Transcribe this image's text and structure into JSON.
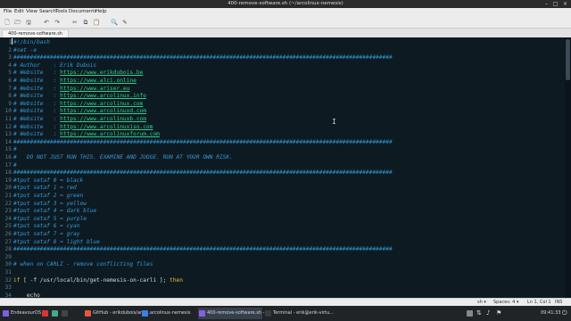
{
  "window": {
    "title": "400-remove-software.sh (~/arcolinux-nemesis)",
    "minimize": "–",
    "maximize": "□",
    "close": "×"
  },
  "menu": [
    "File",
    "Edit",
    "View",
    "Search",
    "Tools",
    "Documents",
    "Help"
  ],
  "toolbar": {
    "new": "🗋",
    "open": "🗁",
    "save": "🖫",
    "undo": "↶",
    "redo": "↷",
    "cut": "✂",
    "copy": "⧉",
    "paste": "📋",
    "find": "🔍",
    "replace": "✎"
  },
  "tab": {
    "label": "400-remove-software.sh"
  },
  "editor": {
    "lines": [
      {
        "n": "1",
        "segs": [
          {
            "c": "cm",
            "t": "#!/bin/bash"
          }
        ]
      },
      {
        "n": "2",
        "segs": [
          {
            "c": "cm",
            "t": "#set -e"
          }
        ]
      },
      {
        "n": "3",
        "segs": [
          {
            "c": "cm",
            "t": "##################################################################################################################"
          }
        ]
      },
      {
        "n": "4",
        "segs": [
          {
            "c": "cm",
            "t": "# Author    : Erik Dubois"
          }
        ]
      },
      {
        "n": "5",
        "segs": [
          {
            "c": "cm",
            "t": "# Website   : "
          },
          {
            "c": "url",
            "t": "https://www.erikdubois.be"
          }
        ]
      },
      {
        "n": "6",
        "segs": [
          {
            "c": "cm",
            "t": "# Website   : "
          },
          {
            "c": "url",
            "t": "https://www.alci.online"
          }
        ]
      },
      {
        "n": "7",
        "segs": [
          {
            "c": "cm",
            "t": "# Website   : "
          },
          {
            "c": "url",
            "t": "https://www.ariser.eu"
          }
        ]
      },
      {
        "n": "8",
        "segs": [
          {
            "c": "cm",
            "t": "# Website   : "
          },
          {
            "c": "url",
            "t": "https://www.arcolinux.info"
          }
        ]
      },
      {
        "n": "9",
        "segs": [
          {
            "c": "cm",
            "t": "# Website   : "
          },
          {
            "c": "url",
            "t": "https://www.arcolinux.com"
          }
        ]
      },
      {
        "n": "10",
        "segs": [
          {
            "c": "cm",
            "t": "# Website   : "
          },
          {
            "c": "url",
            "t": "https://www.arcolinuxd.com"
          }
        ]
      },
      {
        "n": "11",
        "segs": [
          {
            "c": "cm",
            "t": "# Website   : "
          },
          {
            "c": "url",
            "t": "https://www.arcolinuxb.com"
          }
        ]
      },
      {
        "n": "12",
        "segs": [
          {
            "c": "cm",
            "t": "# Website   : "
          },
          {
            "c": "url",
            "t": "https://www.arcolinuxiso.com"
          }
        ]
      },
      {
        "n": "13",
        "segs": [
          {
            "c": "cm",
            "t": "# Website   : "
          },
          {
            "c": "url",
            "t": "https://www.arcolinuxforum.com"
          }
        ]
      },
      {
        "n": "14",
        "segs": [
          {
            "c": "cm",
            "t": "##################################################################################################################"
          }
        ]
      },
      {
        "n": "15",
        "segs": [
          {
            "c": "cm",
            "t": "#"
          }
        ]
      },
      {
        "n": "16",
        "segs": [
          {
            "c": "cm",
            "t": "#   DO NOT JUST RUN THIS. EXAMINE AND JUDGE. RUN AT YOUR OWN RISK."
          }
        ]
      },
      {
        "n": "17",
        "segs": [
          {
            "c": "cm",
            "t": "#"
          }
        ]
      },
      {
        "n": "18",
        "segs": [
          {
            "c": "cm",
            "t": "##################################################################################################################"
          }
        ]
      },
      {
        "n": "19",
        "segs": [
          {
            "c": "cm",
            "t": "#tput setaf 0 = black"
          }
        ]
      },
      {
        "n": "20",
        "segs": [
          {
            "c": "cm",
            "t": "#tput setaf 1 = red"
          }
        ]
      },
      {
        "n": "21",
        "segs": [
          {
            "c": "cm",
            "t": "#tput setaf 2 = green"
          }
        ]
      },
      {
        "n": "22",
        "segs": [
          {
            "c": "cm",
            "t": "#tput setaf 3 = yellow"
          }
        ]
      },
      {
        "n": "23",
        "segs": [
          {
            "c": "cm",
            "t": "#tput setaf 4 = dark blue"
          }
        ]
      },
      {
        "n": "24",
        "segs": [
          {
            "c": "cm",
            "t": "#tput setaf 5 = purple"
          }
        ]
      },
      {
        "n": "25",
        "segs": [
          {
            "c": "cm",
            "t": "#tput setaf 6 = cyan"
          }
        ]
      },
      {
        "n": "26",
        "segs": [
          {
            "c": "cm",
            "t": "#tput setaf 7 = gray"
          }
        ]
      },
      {
        "n": "27",
        "segs": [
          {
            "c": "cm",
            "t": "#tput setaf 8 = light blue"
          }
        ]
      },
      {
        "n": "28",
        "segs": [
          {
            "c": "cm",
            "t": "##################################################################################################################"
          }
        ]
      },
      {
        "n": "29",
        "segs": []
      },
      {
        "n": "30",
        "segs": [
          {
            "c": "cm",
            "t": "# when on CARLI - remove conflicting files"
          }
        ]
      },
      {
        "n": "31",
        "segs": []
      },
      {
        "n": "32",
        "segs": [
          {
            "c": "kw",
            "t": "if"
          },
          {
            "c": "tx",
            "t": " [ -f /usr/local/bin/get-nemesis-on-carli ]; "
          },
          {
            "c": "kw",
            "t": "then"
          }
        ]
      },
      {
        "n": "33",
        "segs": []
      },
      {
        "n": "34",
        "segs": [
          {
            "c": "tx",
            "t": "    echo"
          }
        ]
      }
    ]
  },
  "statusbar": {
    "language": "sh ▾",
    "spaces": "Spaces: 4 ▾",
    "position": "Ln 1, Col 1",
    "mode": "INS"
  },
  "taskbar": {
    "start": "EndeavourOS",
    "tasks": [
      {
        "label": "GitHub - erikdubois/arco...",
        "color": "#e8553d",
        "active": false
      },
      {
        "label": "arcolinux-nemesis",
        "color": "#3d7fe8",
        "active": false
      },
      {
        "label": "400-remove-software.sh - ...",
        "color": "#8a5de8",
        "active": true
      },
      {
        "label": "Terminal - erik@erik-virtu...",
        "color": "#3a3a3a",
        "active": false
      }
    ],
    "clock": "09:41:33"
  }
}
